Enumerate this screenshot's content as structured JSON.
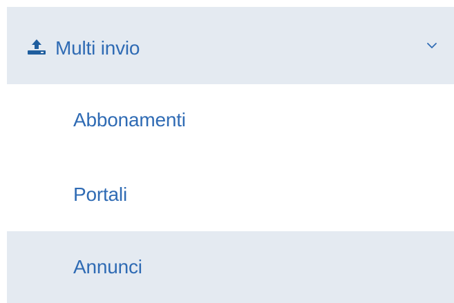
{
  "menu": {
    "header": {
      "label": "Multi invio",
      "icon": "upload-icon",
      "expand_icon": "chevron-down-icon"
    },
    "items": [
      {
        "label": "Abbonamenti"
      },
      {
        "label": "Portali"
      },
      {
        "label": "Annunci",
        "active": true
      }
    ]
  },
  "colors": {
    "text": "#2f6bb4",
    "header_bg": "#e4eaf1",
    "active_bg": "#e4eaf1",
    "icon": "#1f5e9e"
  }
}
